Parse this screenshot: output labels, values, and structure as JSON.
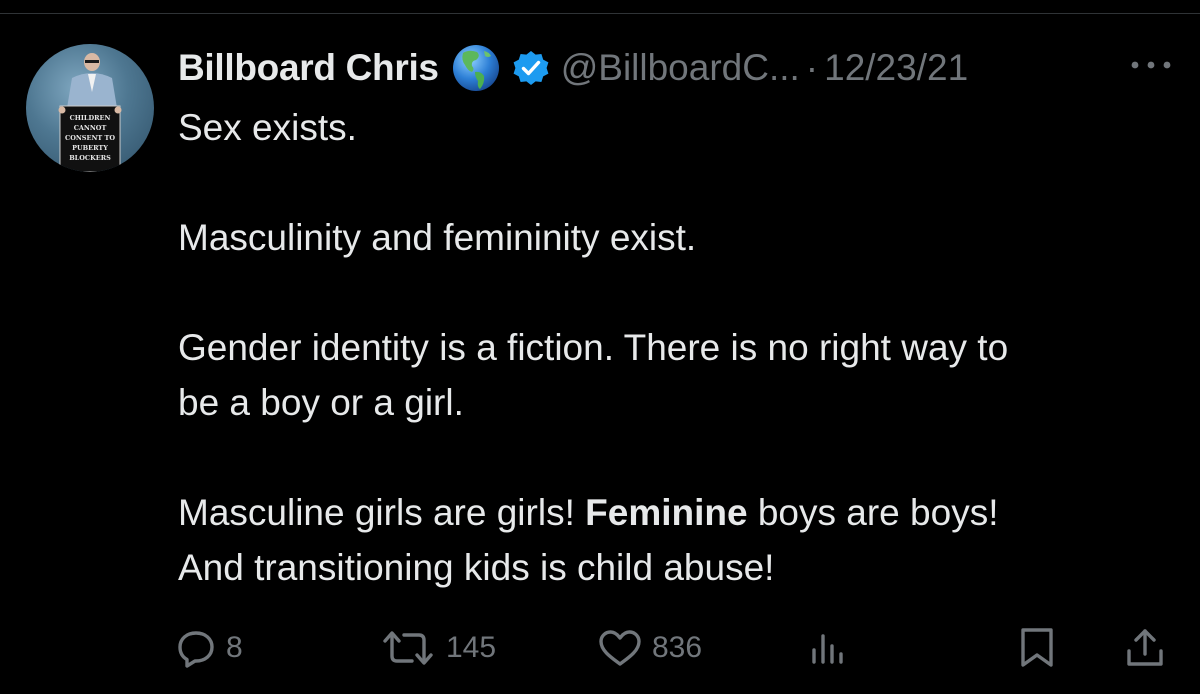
{
  "tweet": {
    "author": {
      "display_name": "Billboard Chris",
      "handle": "@BillboardC...",
      "avatar_sign_lines": [
        "CHILDREN",
        "CANNOT",
        "CONSENT TO",
        "PUBERTY",
        "BLOCKERS"
      ]
    },
    "separator": "·",
    "date": "12/23/21",
    "body": {
      "p1": "Sex exists.",
      "p2": "Masculinity and femininity exist.",
      "p3_line1": "Gender identity is a fiction. There is no right way to",
      "p3_line2": "be a boy or a girl.",
      "p4_part1": "Masculine girls are girls! ",
      "p4_bold": "Feminine",
      "p4_part2": " boys are boys!",
      "p4_line2": "And transitioning kids is child abuse!"
    },
    "metrics": {
      "replies": "8",
      "retweets": "145",
      "likes": "836"
    }
  },
  "icons": {
    "globe": "globe-americas-icon",
    "verified": "verified-badge-icon",
    "more": "more-icon",
    "reply": "reply-icon",
    "retweet": "retweet-icon",
    "like": "heart-icon",
    "views": "views-chart-icon",
    "bookmark": "bookmark-icon",
    "share": "share-icon"
  },
  "colors": {
    "background": "#000000",
    "text_primary": "#e7e9ea",
    "text_secondary": "#71767b",
    "verified_blue": "#1d9bf0"
  }
}
